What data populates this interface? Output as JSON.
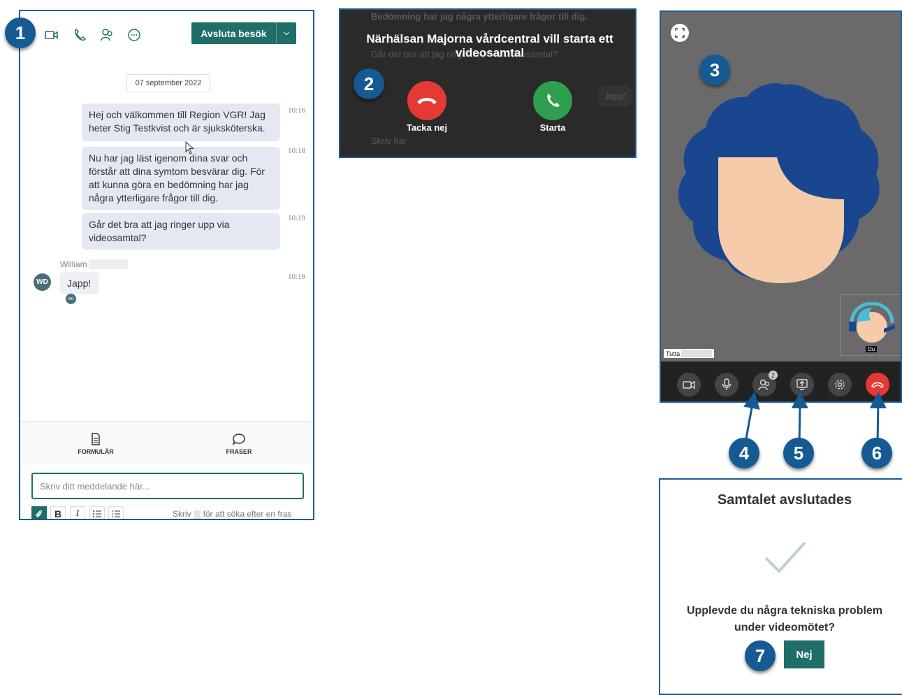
{
  "chat": {
    "end_visit_label": "Avsluta besök",
    "date": "07 september 2022",
    "messages": [
      {
        "text": "Hej och välkommen till Region VGR! Jag heter Stig Testkvist och är sjuksköterska.",
        "time": "10:16"
      },
      {
        "text": "Nu har jag läst igenom dina svar och förstår att dina symtom besvärar dig. För att kunna göra en bedömning har jag några ytterligare frågor till dig.",
        "time": "10:18"
      },
      {
        "text": "Går det bra att jag ringer upp via videosamtal?",
        "time": "10:19"
      }
    ],
    "reply": {
      "sender": "William",
      "avatar": "WD",
      "text": "Japp!",
      "time": "10:19"
    },
    "tabs": {
      "form": "FORMULÄR",
      "phrases": "FRASER"
    },
    "input_placeholder": "Skriv ditt meddelande här...",
    "format": {
      "bold": "B",
      "italic": "I"
    },
    "hint_before": "Skriv",
    "hint_after": "för att söka efter en fras"
  },
  "incoming": {
    "title": "Närhälsan Majorna vårdcentral vill starta ett videosamtal",
    "decline": "Tacka nej",
    "accept": "Starta",
    "background_text": [
      "Bedömning har jag några ytterligare frågor till dig.",
      "Går det bra att jag ringer upp via videosamtal?",
      "Japp!",
      "Skriv här"
    ]
  },
  "video": {
    "remote_name": "Tutta",
    "self_label": "Du",
    "participants_count": "2"
  },
  "ended": {
    "title": "Samtalet avslutades",
    "question": "Upplevde du några tekniska problem under videomötet?",
    "no": "Nej"
  },
  "badges": [
    "1",
    "2",
    "3",
    "4",
    "5",
    "6",
    "7"
  ],
  "colors": {
    "teal": "#1f6f68",
    "badge_blue": "#155a93",
    "hangup_red": "#e53935",
    "accept_green": "#2e9e4f"
  }
}
